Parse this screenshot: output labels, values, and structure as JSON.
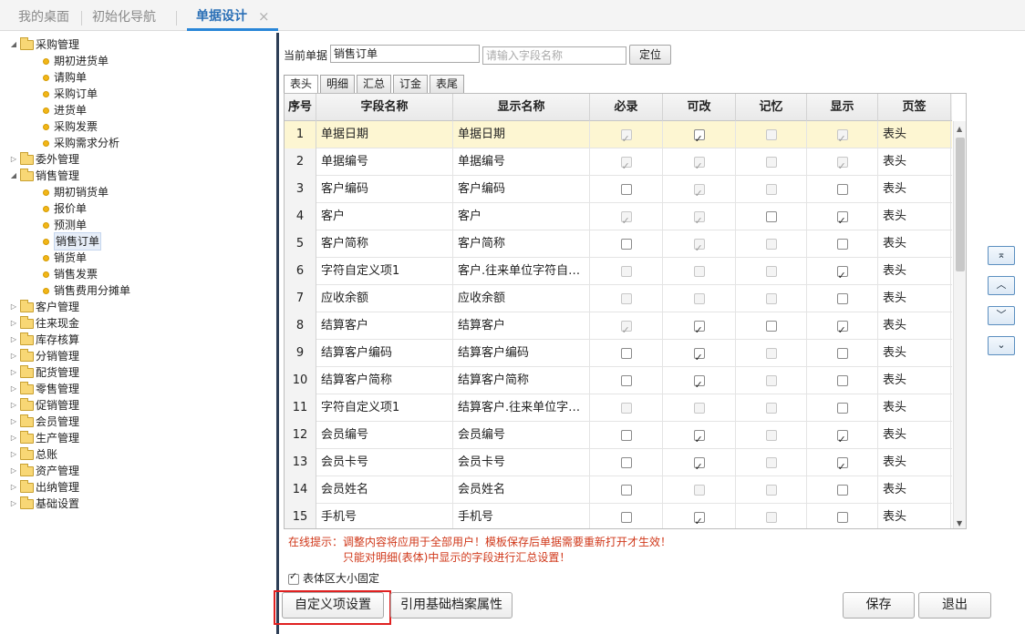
{
  "top_tabs": [
    {
      "label": "我的桌面"
    },
    {
      "label": "初始化导航"
    },
    {
      "label": "单据设计",
      "active": true,
      "close": "×"
    }
  ],
  "tree": [
    {
      "type": "folder",
      "label": "采购管理",
      "expanded": true,
      "toggle": "◢"
    },
    {
      "type": "leaf",
      "label": "期初进货单"
    },
    {
      "type": "leaf",
      "label": "请购单"
    },
    {
      "type": "leaf",
      "label": "采购订单"
    },
    {
      "type": "leaf",
      "label": "进货单"
    },
    {
      "type": "leaf",
      "label": "采购发票"
    },
    {
      "type": "leaf",
      "label": "采购需求分析"
    },
    {
      "type": "folder",
      "label": "委外管理",
      "expanded": false,
      "toggle": "▷"
    },
    {
      "type": "folder",
      "label": "销售管理",
      "expanded": true,
      "toggle": "◢"
    },
    {
      "type": "leaf",
      "label": "期初销货单"
    },
    {
      "type": "leaf",
      "label": "报价单"
    },
    {
      "type": "leaf",
      "label": "预测单"
    },
    {
      "type": "leaf",
      "label": "销售订单",
      "selected": true
    },
    {
      "type": "leaf",
      "label": "销货单"
    },
    {
      "type": "leaf",
      "label": "销售发票"
    },
    {
      "type": "leaf",
      "label": "销售费用分摊单"
    },
    {
      "type": "folder",
      "label": "客户管理",
      "expanded": false,
      "toggle": "▷"
    },
    {
      "type": "folder",
      "label": "往来现金",
      "expanded": false,
      "toggle": "▷"
    },
    {
      "type": "folder",
      "label": "库存核算",
      "expanded": false,
      "toggle": "▷"
    },
    {
      "type": "folder",
      "label": "分销管理",
      "expanded": false,
      "toggle": "▷"
    },
    {
      "type": "folder",
      "label": "配货管理",
      "expanded": false,
      "toggle": "▷"
    },
    {
      "type": "folder",
      "label": "零售管理",
      "expanded": false,
      "toggle": "▷"
    },
    {
      "type": "folder",
      "label": "促销管理",
      "expanded": false,
      "toggle": "▷"
    },
    {
      "type": "folder",
      "label": "会员管理",
      "expanded": false,
      "toggle": "▷"
    },
    {
      "type": "folder",
      "label": "生产管理",
      "expanded": false,
      "toggle": "▷"
    },
    {
      "type": "folder",
      "label": "总账",
      "expanded": false,
      "toggle": "▷"
    },
    {
      "type": "folder",
      "label": "资产管理",
      "expanded": false,
      "toggle": "▷"
    },
    {
      "type": "folder",
      "label": "出纳管理",
      "expanded": false,
      "toggle": "▷"
    },
    {
      "type": "folder",
      "label": "基础设置",
      "expanded": false,
      "toggle": "▷"
    }
  ],
  "current_doc": {
    "label": "当前单据",
    "value": "销售订单",
    "field_placeholder": "请输入字段名称",
    "locate_button": "定位"
  },
  "sub_tabs": [
    "表头",
    "明细",
    "汇总",
    "订金",
    "表尾"
  ],
  "grid": {
    "headers": [
      "序号",
      "字段名称",
      "显示名称",
      "必录",
      "可改",
      "记忆",
      "显示",
      "页签"
    ],
    "rows": [
      {
        "seq": "1",
        "field": "单据日期",
        "display": "单据日期",
        "req": [
          1,
          1
        ],
        "edit": [
          1,
          0
        ],
        "mem": [
          0,
          1
        ],
        "show": [
          1,
          1
        ],
        "tab": "表头"
      },
      {
        "seq": "2",
        "field": "单据编号",
        "display": "单据编号",
        "req": [
          1,
          1
        ],
        "edit": [
          1,
          1
        ],
        "mem": [
          0,
          1
        ],
        "show": [
          1,
          1
        ],
        "tab": "表头"
      },
      {
        "seq": "3",
        "field": "客户编码",
        "display": "客户编码",
        "req": [
          0,
          0
        ],
        "edit": [
          1,
          1
        ],
        "mem": [
          0,
          1
        ],
        "show": [
          0,
          0
        ],
        "tab": "表头"
      },
      {
        "seq": "4",
        "field": "客户",
        "display": "客户",
        "req": [
          1,
          1
        ],
        "edit": [
          1,
          1
        ],
        "mem": [
          0,
          0
        ],
        "show": [
          1,
          0
        ],
        "tab": "表头"
      },
      {
        "seq": "5",
        "field": "客户简称",
        "display": "客户简称",
        "req": [
          0,
          0
        ],
        "edit": [
          1,
          1
        ],
        "mem": [
          0,
          1
        ],
        "show": [
          0,
          0
        ],
        "tab": "表头"
      },
      {
        "seq": "6",
        "field": "字符自定义项1",
        "display": "客户.往来单位字符自…",
        "req": [
          0,
          1
        ],
        "edit": [
          0,
          1
        ],
        "mem": [
          0,
          1
        ],
        "show": [
          1,
          0
        ],
        "tab": "表头"
      },
      {
        "seq": "7",
        "field": "应收余额",
        "display": "应收余额",
        "req": [
          0,
          1
        ],
        "edit": [
          0,
          1
        ],
        "mem": [
          0,
          1
        ],
        "show": [
          0,
          0
        ],
        "tab": "表头"
      },
      {
        "seq": "8",
        "field": "结算客户",
        "display": "结算客户",
        "req": [
          1,
          1
        ],
        "edit": [
          1,
          0
        ],
        "mem": [
          0,
          0
        ],
        "show": [
          1,
          0
        ],
        "tab": "表头"
      },
      {
        "seq": "9",
        "field": "结算客户编码",
        "display": "结算客户编码",
        "req": [
          0,
          0
        ],
        "edit": [
          1,
          0
        ],
        "mem": [
          0,
          1
        ],
        "show": [
          0,
          0
        ],
        "tab": "表头"
      },
      {
        "seq": "10",
        "field": "结算客户简称",
        "display": "结算客户简称",
        "req": [
          0,
          0
        ],
        "edit": [
          1,
          0
        ],
        "mem": [
          0,
          1
        ],
        "show": [
          0,
          0
        ],
        "tab": "表头"
      },
      {
        "seq": "11",
        "field": "字符自定义项1",
        "display": "结算客户.往来单位字…",
        "req": [
          0,
          1
        ],
        "edit": [
          0,
          1
        ],
        "mem": [
          0,
          1
        ],
        "show": [
          0,
          0
        ],
        "tab": "表头"
      },
      {
        "seq": "12",
        "field": "会员编号",
        "display": "会员编号",
        "req": [
          0,
          0
        ],
        "edit": [
          1,
          0
        ],
        "mem": [
          0,
          1
        ],
        "show": [
          1,
          0
        ],
        "tab": "表头"
      },
      {
        "seq": "13",
        "field": "会员卡号",
        "display": "会员卡号",
        "req": [
          0,
          0
        ],
        "edit": [
          1,
          0
        ],
        "mem": [
          0,
          1
        ],
        "show": [
          1,
          0
        ],
        "tab": "表头"
      },
      {
        "seq": "14",
        "field": "会员姓名",
        "display": "会员姓名",
        "req": [
          0,
          0
        ],
        "edit": [
          0,
          1
        ],
        "mem": [
          0,
          1
        ],
        "show": [
          0,
          0
        ],
        "tab": "表头"
      },
      {
        "seq": "15",
        "field": "手机号",
        "display": "手机号",
        "req": [
          0,
          0
        ],
        "edit": [
          1,
          0
        ],
        "mem": [
          0,
          1
        ],
        "show": [
          0,
          0
        ],
        "tab": "表头"
      }
    ]
  },
  "move_buttons": [
    "⌅",
    "︿",
    "﹀",
    "⌄"
  ],
  "hint_line1": "在线提示：调整内容将应用于全部用户！模板保存后单据需要重新打开才生效！",
  "hint_line2": "只能对明细(表体)中显示的字段进行汇总设置！",
  "fixed_size_label": "表体区大小固定",
  "fixed_size_checked": true,
  "buttons": {
    "custom": "自定义项设置",
    "ref_base": "引用基础档案属性",
    "save": "保存",
    "exit": "退出"
  }
}
